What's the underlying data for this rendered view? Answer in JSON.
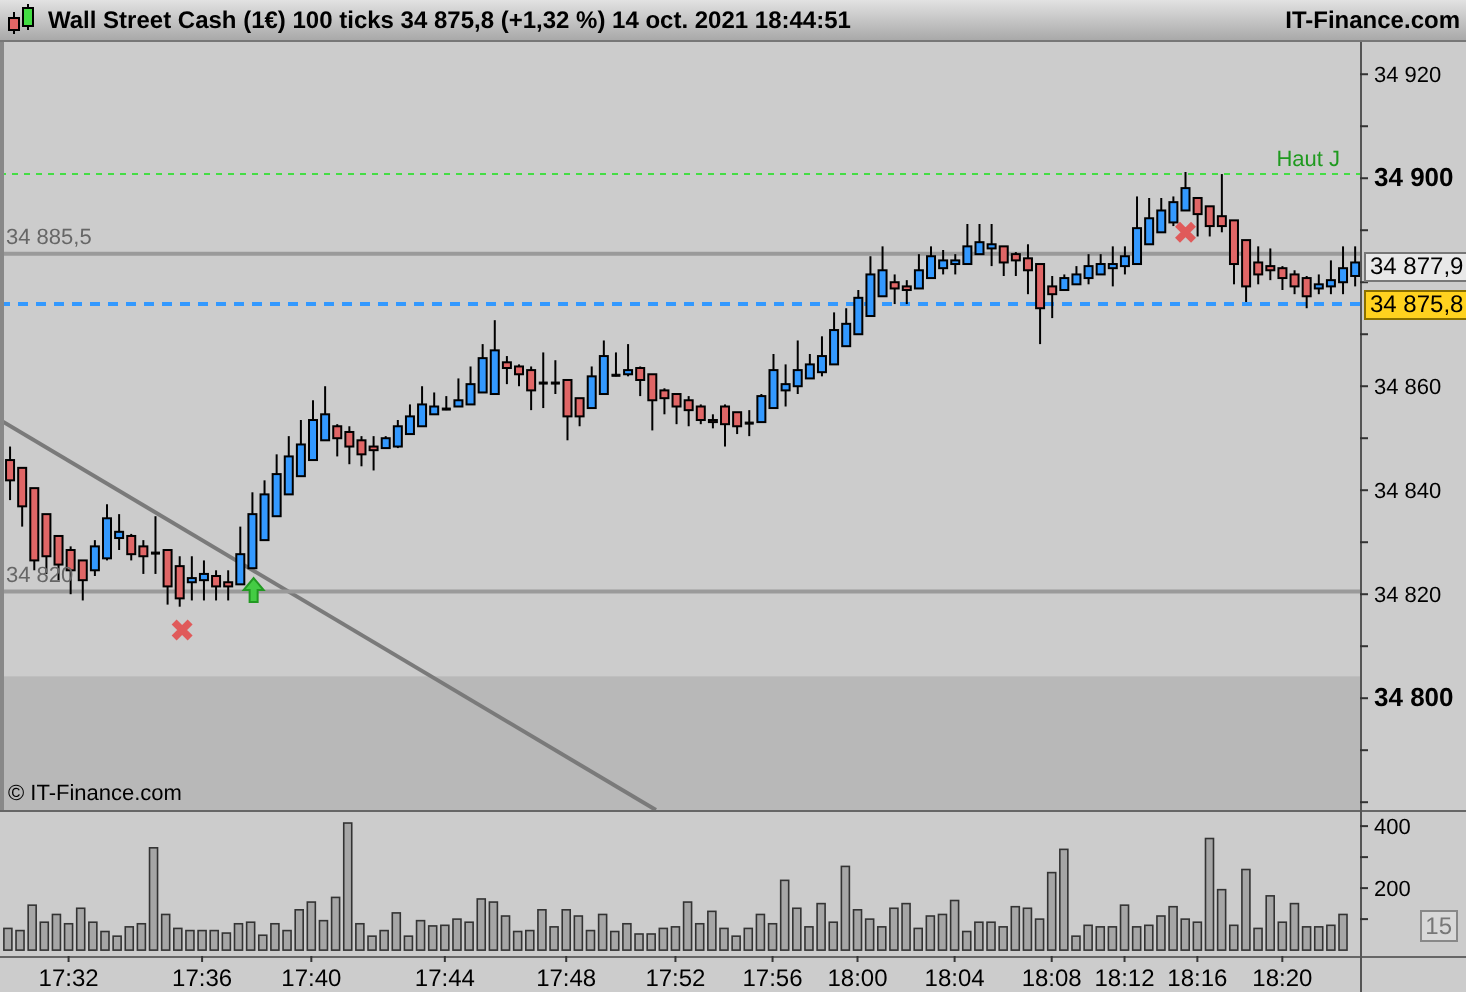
{
  "header": {
    "title": "Wall Street Cash (1€) 100 ticks 34 875,8 (+1,32 %) 14 oct. 2021 18:44:51",
    "site": "IT-Finance.com"
  },
  "price_chart": {
    "copyright": "© IT-Finance.com",
    "price_labels": [
      {
        "kind": "last",
        "label": "34 877,9"
      },
      {
        "kind": "current",
        "label": "34 875,8"
      }
    ],
    "chart_data": {
      "type": "candlestick",
      "ylim": [
        34778.5,
        34926.2
      ],
      "yticks": [
        {
          "value": 34920,
          "label": "34 920"
        },
        {
          "value": 34900,
          "label": "34 900"
        },
        {
          "value": 34860,
          "label": "34 860"
        },
        {
          "value": 34840,
          "label": "34 840"
        },
        {
          "value": 34820,
          "label": "34 820"
        },
        {
          "value": 34800,
          "label": "34 800"
        }
      ],
      "categories": [
        null,
        null,
        null,
        null,
        null,
        null,
        null,
        null,
        null,
        null,
        null,
        null,
        null,
        null,
        null,
        null,
        null,
        null,
        null,
        null,
        null,
        null,
        null,
        null,
        null,
        null,
        null,
        null,
        null,
        null,
        null,
        null,
        null,
        null,
        null,
        null,
        null,
        null,
        null,
        null,
        null,
        null,
        null,
        null,
        null,
        null,
        null,
        null,
        null,
        null,
        null,
        null,
        null,
        null,
        null,
        null,
        null,
        null,
        null,
        null,
        null,
        null,
        null,
        null,
        null,
        null,
        null,
        null,
        null,
        null,
        null,
        null,
        null,
        null,
        null,
        null,
        null,
        null,
        null,
        null,
        null,
        null,
        null,
        null,
        null,
        null,
        null,
        null,
        null,
        null,
        null,
        null,
        null,
        null,
        null,
        null,
        null,
        null,
        null,
        null,
        null,
        null,
        null,
        null,
        null,
        null,
        null,
        null,
        null,
        null,
        null,
        null
      ],
      "ohlc": [
        [
          34845.8,
          34848.4,
          34838.1,
          34841.9
        ],
        [
          34844.3,
          34844.3,
          34833.0,
          34836.9
        ],
        [
          34840.4,
          34840.4,
          34824.6,
          34826.5
        ],
        [
          34835.4,
          34835.4,
          34823.9,
          34827.3
        ],
        [
          34831.2,
          34831.2,
          34822.7,
          34825.7
        ],
        [
          34828.5,
          34829.2,
          34820.0,
          34824.6
        ],
        [
          34826.5,
          34826.5,
          34818.8,
          34822.7
        ],
        [
          34824.6,
          34830.4,
          34823.5,
          34829.2
        ],
        [
          34826.9,
          34837.3,
          34826.5,
          34834.6
        ],
        [
          34830.8,
          34835.4,
          34828.5,
          34832.0
        ],
        [
          34831.2,
          34831.6,
          34826.5,
          34827.7
        ],
        [
          34829.2,
          34830.4,
          34823.9,
          34827.3
        ],
        [
          34828.1,
          34835.0,
          34823.9,
          34828.1
        ],
        [
          34828.5,
          34828.5,
          34818.0,
          34821.5
        ],
        [
          34825.4,
          34827.3,
          34817.6,
          34819.2
        ],
        [
          34822.3,
          34827.3,
          34818.8,
          34823.1
        ],
        [
          34822.7,
          34826.5,
          34818.8,
          34823.9
        ],
        [
          34823.5,
          34824.6,
          34818.8,
          34821.5
        ],
        [
          34822.3,
          34824.6,
          34818.8,
          34821.5
        ],
        [
          34821.9,
          34833.0,
          34821.9,
          34827.7
        ],
        [
          34825.0,
          34839.6,
          34825.0,
          34835.4
        ],
        [
          34830.4,
          34841.9,
          34830.4,
          34839.2
        ],
        [
          34835.0,
          34846.9,
          34835.0,
          34843.1
        ],
        [
          34839.2,
          34850.4,
          34839.2,
          34846.5
        ],
        [
          34842.7,
          34853.5,
          34842.7,
          34848.8
        ],
        [
          34845.8,
          34857.3,
          34845.8,
          34853.5
        ],
        [
          34849.6,
          34860.0,
          34849.6,
          34854.6
        ],
        [
          34852.3,
          34852.7,
          34846.5,
          34850.0
        ],
        [
          34851.2,
          34852.3,
          34845.0,
          34848.4
        ],
        [
          34849.6,
          34850.4,
          34844.6,
          34846.9
        ],
        [
          34848.4,
          34850.4,
          34843.8,
          34847.7
        ],
        [
          34848.1,
          34850.4,
          34848.1,
          34850.0
        ],
        [
          34848.4,
          34853.5,
          34848.1,
          34852.3
        ],
        [
          34850.8,
          34856.5,
          34850.8,
          34854.2
        ],
        [
          34852.3,
          34860.0,
          34852.3,
          34856.5
        ],
        [
          34854.6,
          34858.8,
          34854.6,
          34856.1
        ],
        [
          34855.8,
          34858.1,
          34855.4,
          34855.8
        ],
        [
          34856.1,
          34861.5,
          34856.1,
          34857.3
        ],
        [
          34856.5,
          34863.8,
          34856.5,
          34860.4
        ],
        [
          34858.8,
          34868.1,
          34858.8,
          34865.4
        ],
        [
          34858.5,
          34872.7,
          34858.5,
          34866.9
        ],
        [
          34864.6,
          34865.8,
          34860.4,
          34863.5
        ],
        [
          34863.8,
          34864.2,
          34860.0,
          34862.3
        ],
        [
          34863.1,
          34863.8,
          34855.4,
          34859.2
        ],
        [
          34860.8,
          34866.5,
          34855.8,
          34860.8
        ],
        [
          34860.8,
          34865.0,
          34858.5,
          34860.8
        ],
        [
          34861.2,
          34861.2,
          34849.6,
          34854.2
        ],
        [
          34857.7,
          34857.7,
          34852.3,
          34854.2
        ],
        [
          34855.8,
          34863.8,
          34855.8,
          34861.9
        ],
        [
          34858.5,
          34868.8,
          34858.5,
          34865.8
        ],
        [
          34862.3,
          34866.5,
          34861.9,
          34862.3
        ],
        [
          34862.3,
          34868.1,
          34861.9,
          34863.1
        ],
        [
          34863.5,
          34863.8,
          34858.1,
          34861.2
        ],
        [
          34862.3,
          34862.3,
          34851.5,
          34857.3
        ],
        [
          34859.2,
          34859.6,
          34854.6,
          34857.7
        ],
        [
          34858.5,
          34858.5,
          34852.7,
          34856.1
        ],
        [
          34857.3,
          34858.1,
          34852.3,
          34855.4
        ],
        [
          34856.1,
          34856.5,
          34852.7,
          34853.5
        ],
        [
          34853.5,
          34854.6,
          34851.9,
          34853.1
        ],
        [
          34856.1,
          34856.5,
          34848.4,
          34852.7
        ],
        [
          34855.0,
          34855.0,
          34850.8,
          34852.3
        ],
        [
          34853.1,
          34855.4,
          34850.4,
          34853.1
        ],
        [
          34853.1,
          34858.5,
          34853.1,
          34858.1
        ],
        [
          34855.8,
          34866.2,
          34855.8,
          34863.1
        ],
        [
          34859.2,
          34864.2,
          34856.1,
          34860.4
        ],
        [
          34860.0,
          34868.8,
          34858.5,
          34863.1
        ],
        [
          34861.5,
          34866.2,
          34861.5,
          34864.2
        ],
        [
          34862.7,
          34869.6,
          34861.9,
          34865.8
        ],
        [
          34864.2,
          34874.2,
          34864.2,
          34870.8
        ],
        [
          34867.7,
          34875.0,
          34867.7,
          34872.0
        ],
        [
          34870.0,
          34878.5,
          34870.0,
          34877.0
        ],
        [
          34873.5,
          34885.0,
          34873.5,
          34881.5
        ],
        [
          34877.3,
          34886.9,
          34877.3,
          34882.3
        ],
        [
          34880.0,
          34881.5,
          34875.8,
          34878.8
        ],
        [
          34879.2,
          34880.4,
          34875.8,
          34878.5
        ],
        [
          34878.8,
          34885.4,
          34878.8,
          34882.3
        ],
        [
          34880.8,
          34886.9,
          34880.8,
          34885.0
        ],
        [
          34882.7,
          34886.2,
          34881.5,
          34884.2
        ],
        [
          34883.5,
          34885.4,
          34881.5,
          34884.2
        ],
        [
          34883.5,
          34891.2,
          34883.5,
          34886.9
        ],
        [
          34885.4,
          34891.2,
          34885.4,
          34887.7
        ],
        [
          34886.5,
          34891.2,
          34883.1,
          34887.3
        ],
        [
          34886.9,
          34886.9,
          34881.2,
          34883.8
        ],
        [
          34885.4,
          34885.8,
          34881.2,
          34884.2
        ],
        [
          34884.6,
          34887.3,
          34877.7,
          34882.3
        ],
        [
          34883.5,
          34883.5,
          34868.1,
          34875.0
        ],
        [
          34879.2,
          34881.2,
          34873.1,
          34877.7
        ],
        [
          34878.5,
          34881.5,
          34878.5,
          34880.8
        ],
        [
          34879.6,
          34883.1,
          34879.6,
          34881.5
        ],
        [
          34880.8,
          34885.4,
          34879.6,
          34883.1
        ],
        [
          34881.5,
          34885.4,
          34881.5,
          34883.5
        ],
        [
          34882.7,
          34886.9,
          34879.2,
          34883.5
        ],
        [
          34883.1,
          34886.9,
          34881.5,
          34885.0
        ],
        [
          34883.5,
          34896.5,
          34883.5,
          34890.4
        ],
        [
          34887.3,
          34896.2,
          34887.3,
          34892.3
        ],
        [
          34889.6,
          34896.2,
          34889.6,
          34893.8
        ],
        [
          34891.5,
          34896.5,
          34890.8,
          34895.4
        ],
        [
          34893.8,
          34901.2,
          34893.8,
          34898.1
        ],
        [
          34896.2,
          34896.2,
          34888.8,
          34893.1
        ],
        [
          34894.6,
          34894.6,
          34888.8,
          34890.8
        ],
        [
          34892.7,
          34900.8,
          34889.6,
          34890.8
        ],
        [
          34891.9,
          34891.9,
          34879.6,
          34883.5
        ],
        [
          34888.1,
          34888.1,
          34876.2,
          34879.2
        ],
        [
          34883.8,
          34886.9,
          34879.6,
          34881.5
        ],
        [
          34883.1,
          34886.5,
          34880.4,
          34882.3
        ],
        [
          34882.7,
          34883.1,
          34878.5,
          34880.8
        ],
        [
          34881.5,
          34882.3,
          34877.7,
          34879.2
        ],
        [
          34880.8,
          34881.2,
          34875.0,
          34877.3
        ],
        [
          34878.8,
          34881.5,
          34877.7,
          34879.6
        ],
        [
          34879.2,
          34884.2,
          34877.7,
          34880.4
        ],
        [
          34880.0,
          34886.9,
          34877.7,
          34882.7
        ],
        [
          34881.2,
          34886.9,
          34879.2,
          34883.8
        ]
      ],
      "ref_lines": [
        {
          "axis": "y",
          "value": 34885.5,
          "label": "34 885,5"
        },
        {
          "axis": "y",
          "value": 34820.5,
          "label": "34 820"
        },
        {
          "axis": "y",
          "value": 34900.8,
          "label": "Haut J",
          "color": "#44dd44"
        },
        {
          "axis": "y",
          "value": 34875.8,
          "color": "#3399ff"
        }
      ]
    }
  },
  "volume_panel": {
    "period_badge": "15",
    "chart_data": {
      "type": "bar",
      "ylim": [
        -19,
        452
      ],
      "yticks": [
        {
          "value": 400,
          "label": "400"
        },
        {
          "value": 200,
          "label": "200"
        }
      ],
      "categories": [
        null,
        null,
        null,
        null,
        null,
        "17:32",
        null,
        null,
        null,
        null,
        null,
        null,
        null,
        null,
        null,
        null,
        "17:36",
        null,
        null,
        null,
        null,
        null,
        null,
        null,
        null,
        "17:40",
        null,
        null,
        null,
        null,
        null,
        null,
        null,
        null,
        null,
        null,
        "17:44",
        null,
        null,
        null,
        null,
        null,
        null,
        null,
        null,
        null,
        "17:48",
        null,
        null,
        null,
        null,
        null,
        null,
        null,
        null,
        "17:52",
        null,
        null,
        null,
        null,
        null,
        null,
        null,
        "17:56",
        null,
        null,
        null,
        null,
        null,
        null,
        "18:00",
        null,
        null,
        null,
        null,
        null,
        null,
        null,
        "18:04",
        null,
        null,
        null,
        null,
        null,
        null,
        null,
        "18:08",
        null,
        null,
        null,
        null,
        null,
        "18:12",
        null,
        null,
        null,
        null,
        null,
        "18:16",
        null,
        null,
        null,
        null,
        null,
        null,
        "18:20",
        null,
        null,
        null,
        null,
        null
      ],
      "values": [
        70,
        63,
        145,
        90,
        115,
        85,
        135,
        90,
        60,
        45,
        75,
        85,
        330,
        115,
        70,
        63,
        63,
        63,
        55,
        85,
        90,
        48,
        85,
        63,
        130,
        155,
        95,
        170,
        410,
        85,
        45,
        63,
        120,
        45,
        95,
        78,
        80,
        100,
        90,
        165,
        155,
        110,
        60,
        63,
        130,
        75,
        130,
        110,
        63,
        115,
        60,
        85,
        52,
        52,
        70,
        75,
        155,
        85,
        125,
        70,
        45,
        70,
        115,
        85,
        225,
        135,
        75,
        150,
        90,
        270,
        130,
        100,
        75,
        135,
        150,
        70,
        110,
        115,
        160,
        60,
        90,
        90,
        75,
        140,
        135,
        100,
        250,
        325,
        45,
        80,
        75,
        75,
        145,
        75,
        80,
        110,
        140,
        100,
        90,
        360,
        195,
        80,
        260,
        70,
        175,
        90,
        150,
        75,
        75,
        80,
        115
      ]
    }
  }
}
